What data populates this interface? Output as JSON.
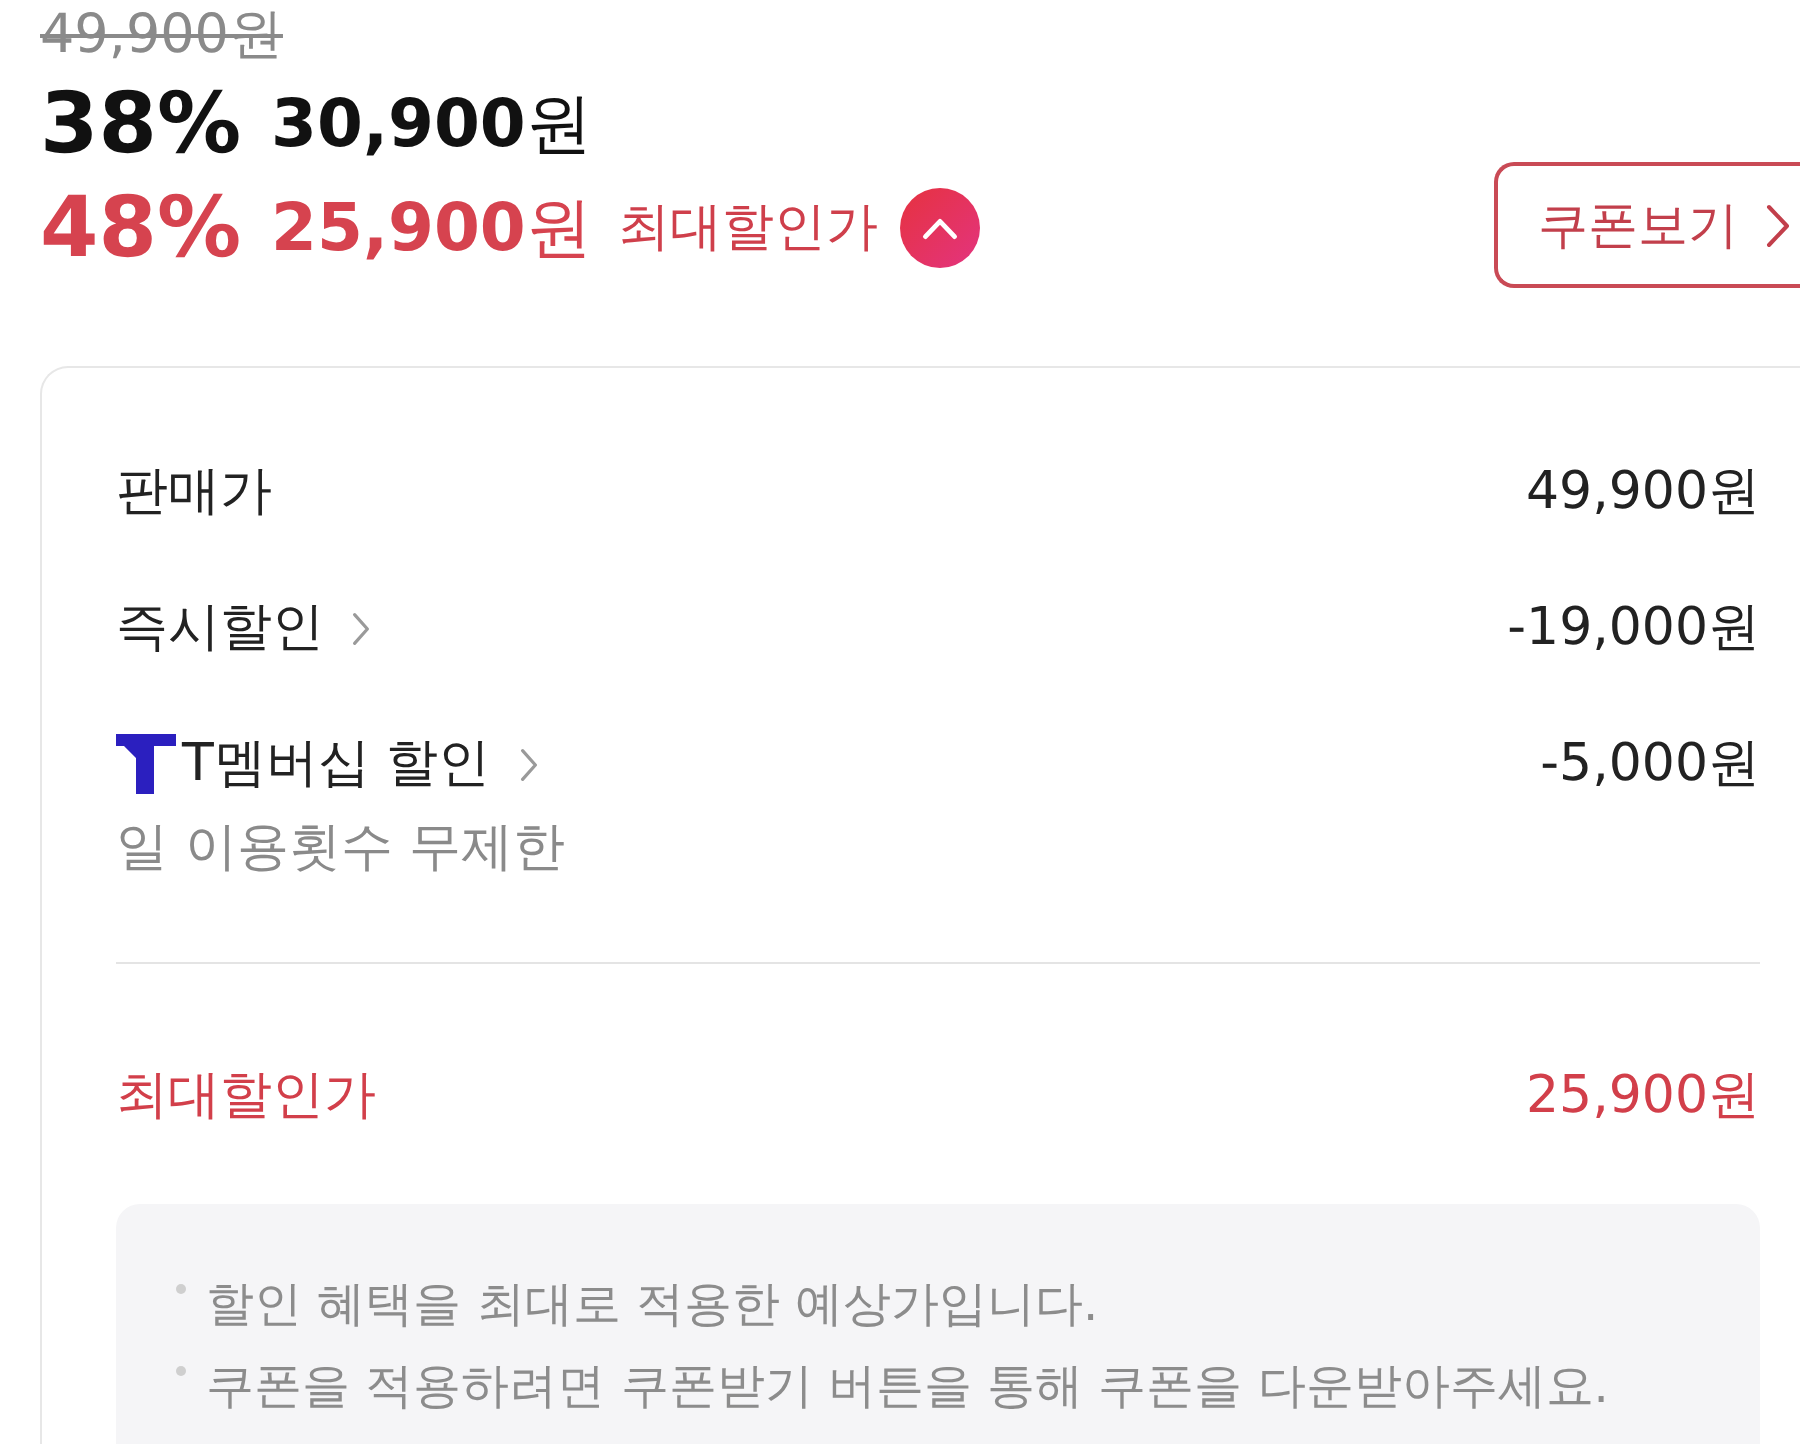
{
  "price": {
    "original": "49,900원",
    "discount_rate": "38%",
    "sale_price": "**30,900**원"
  },
  "max_discount": {
    "rate": "48%",
    "price": "**25,900**원",
    "label": "최대할인가",
    "expanded": true
  },
  "coupon_button": {
    "label": "쿠폰보기"
  },
  "breakdown": {
    "rows": [
      {
        "kind": "plain",
        "label": "판매가",
        "amount": "49,900원"
      },
      {
        "kind": "link",
        "label": "즉시할인",
        "amount": "-19,000원"
      },
      {
        "kind": "membership",
        "label": "T멤버십 할인",
        "amount": "-5,000원",
        "note": "일 이용횟수 무제한"
      }
    ],
    "total": {
      "label": "최대할인가",
      "amount": "25,900원"
    },
    "notes": [
      "할인 혜택을 최대로 적용한 예상가입니다.",
      "쿠폰을 적용하려면 쿠폰받기 버튼을 통해 쿠폰을 다운받아주세요."
    ]
  }
}
